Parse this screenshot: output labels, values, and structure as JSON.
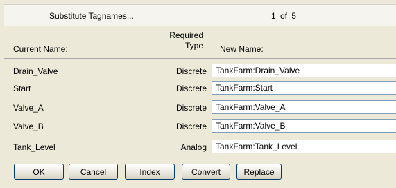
{
  "header": {
    "title": "Substitute Tagnames...",
    "page_count": "1 of  5"
  },
  "columns": {
    "current_name": "Current Name:",
    "required_type_line1": "Required",
    "required_type_line2": "Type",
    "new_name": "New Name:"
  },
  "rows": [
    {
      "current": "Drain_Valve",
      "type": "Discrete",
      "new": "TankFarm:Drain_Valve"
    },
    {
      "current": "Start",
      "type": "Discrete",
      "new": "TankFarm:Start"
    },
    {
      "current": "Valve_A",
      "type": "Discrete",
      "new": "TankFarm:Valve_A"
    },
    {
      "current": "Valve_B",
      "type": "Discrete",
      "new": "TankFarm:Valve_B"
    },
    {
      "current": "Tank_Level",
      "type": "Analog",
      "new": "TankFarm:Tank_Level"
    }
  ],
  "buttons": {
    "ok": "OK",
    "cancel": "Cancel",
    "index": "Index",
    "convert": "Convert",
    "replace": "Replace"
  }
}
